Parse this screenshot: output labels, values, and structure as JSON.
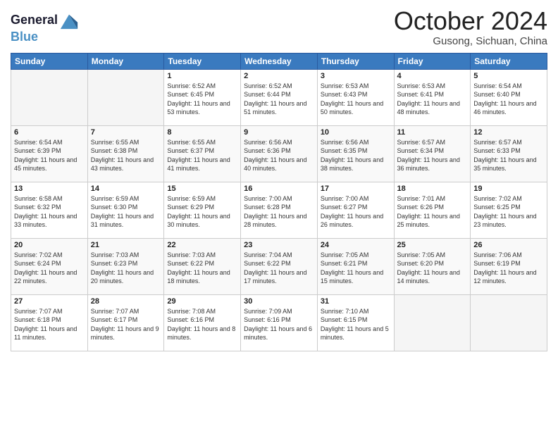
{
  "logo": {
    "line1": "General",
    "line2": "Blue"
  },
  "title": "October 2024",
  "location": "Gusong, Sichuan, China",
  "days_of_week": [
    "Sunday",
    "Monday",
    "Tuesday",
    "Wednesday",
    "Thursday",
    "Friday",
    "Saturday"
  ],
  "weeks": [
    [
      {
        "day": "",
        "content": ""
      },
      {
        "day": "",
        "content": ""
      },
      {
        "day": "1",
        "content": "Sunrise: 6:52 AM\nSunset: 6:45 PM\nDaylight: 11 hours and 53 minutes."
      },
      {
        "day": "2",
        "content": "Sunrise: 6:52 AM\nSunset: 6:44 PM\nDaylight: 11 hours and 51 minutes."
      },
      {
        "day": "3",
        "content": "Sunrise: 6:53 AM\nSunset: 6:43 PM\nDaylight: 11 hours and 50 minutes."
      },
      {
        "day": "4",
        "content": "Sunrise: 6:53 AM\nSunset: 6:41 PM\nDaylight: 11 hours and 48 minutes."
      },
      {
        "day": "5",
        "content": "Sunrise: 6:54 AM\nSunset: 6:40 PM\nDaylight: 11 hours and 46 minutes."
      }
    ],
    [
      {
        "day": "6",
        "content": "Sunrise: 6:54 AM\nSunset: 6:39 PM\nDaylight: 11 hours and 45 minutes."
      },
      {
        "day": "7",
        "content": "Sunrise: 6:55 AM\nSunset: 6:38 PM\nDaylight: 11 hours and 43 minutes."
      },
      {
        "day": "8",
        "content": "Sunrise: 6:55 AM\nSunset: 6:37 PM\nDaylight: 11 hours and 41 minutes."
      },
      {
        "day": "9",
        "content": "Sunrise: 6:56 AM\nSunset: 6:36 PM\nDaylight: 11 hours and 40 minutes."
      },
      {
        "day": "10",
        "content": "Sunrise: 6:56 AM\nSunset: 6:35 PM\nDaylight: 11 hours and 38 minutes."
      },
      {
        "day": "11",
        "content": "Sunrise: 6:57 AM\nSunset: 6:34 PM\nDaylight: 11 hours and 36 minutes."
      },
      {
        "day": "12",
        "content": "Sunrise: 6:57 AM\nSunset: 6:33 PM\nDaylight: 11 hours and 35 minutes."
      }
    ],
    [
      {
        "day": "13",
        "content": "Sunrise: 6:58 AM\nSunset: 6:32 PM\nDaylight: 11 hours and 33 minutes."
      },
      {
        "day": "14",
        "content": "Sunrise: 6:59 AM\nSunset: 6:30 PM\nDaylight: 11 hours and 31 minutes."
      },
      {
        "day": "15",
        "content": "Sunrise: 6:59 AM\nSunset: 6:29 PM\nDaylight: 11 hours and 30 minutes."
      },
      {
        "day": "16",
        "content": "Sunrise: 7:00 AM\nSunset: 6:28 PM\nDaylight: 11 hours and 28 minutes."
      },
      {
        "day": "17",
        "content": "Sunrise: 7:00 AM\nSunset: 6:27 PM\nDaylight: 11 hours and 26 minutes."
      },
      {
        "day": "18",
        "content": "Sunrise: 7:01 AM\nSunset: 6:26 PM\nDaylight: 11 hours and 25 minutes."
      },
      {
        "day": "19",
        "content": "Sunrise: 7:02 AM\nSunset: 6:25 PM\nDaylight: 11 hours and 23 minutes."
      }
    ],
    [
      {
        "day": "20",
        "content": "Sunrise: 7:02 AM\nSunset: 6:24 PM\nDaylight: 11 hours and 22 minutes."
      },
      {
        "day": "21",
        "content": "Sunrise: 7:03 AM\nSunset: 6:23 PM\nDaylight: 11 hours and 20 minutes."
      },
      {
        "day": "22",
        "content": "Sunrise: 7:03 AM\nSunset: 6:22 PM\nDaylight: 11 hours and 18 minutes."
      },
      {
        "day": "23",
        "content": "Sunrise: 7:04 AM\nSunset: 6:22 PM\nDaylight: 11 hours and 17 minutes."
      },
      {
        "day": "24",
        "content": "Sunrise: 7:05 AM\nSunset: 6:21 PM\nDaylight: 11 hours and 15 minutes."
      },
      {
        "day": "25",
        "content": "Sunrise: 7:05 AM\nSunset: 6:20 PM\nDaylight: 11 hours and 14 minutes."
      },
      {
        "day": "26",
        "content": "Sunrise: 7:06 AM\nSunset: 6:19 PM\nDaylight: 11 hours and 12 minutes."
      }
    ],
    [
      {
        "day": "27",
        "content": "Sunrise: 7:07 AM\nSunset: 6:18 PM\nDaylight: 11 hours and 11 minutes."
      },
      {
        "day": "28",
        "content": "Sunrise: 7:07 AM\nSunset: 6:17 PM\nDaylight: 11 hours and 9 minutes."
      },
      {
        "day": "29",
        "content": "Sunrise: 7:08 AM\nSunset: 6:16 PM\nDaylight: 11 hours and 8 minutes."
      },
      {
        "day": "30",
        "content": "Sunrise: 7:09 AM\nSunset: 6:16 PM\nDaylight: 11 hours and 6 minutes."
      },
      {
        "day": "31",
        "content": "Sunrise: 7:10 AM\nSunset: 6:15 PM\nDaylight: 11 hours and 5 minutes."
      },
      {
        "day": "",
        "content": ""
      },
      {
        "day": "",
        "content": ""
      }
    ]
  ]
}
